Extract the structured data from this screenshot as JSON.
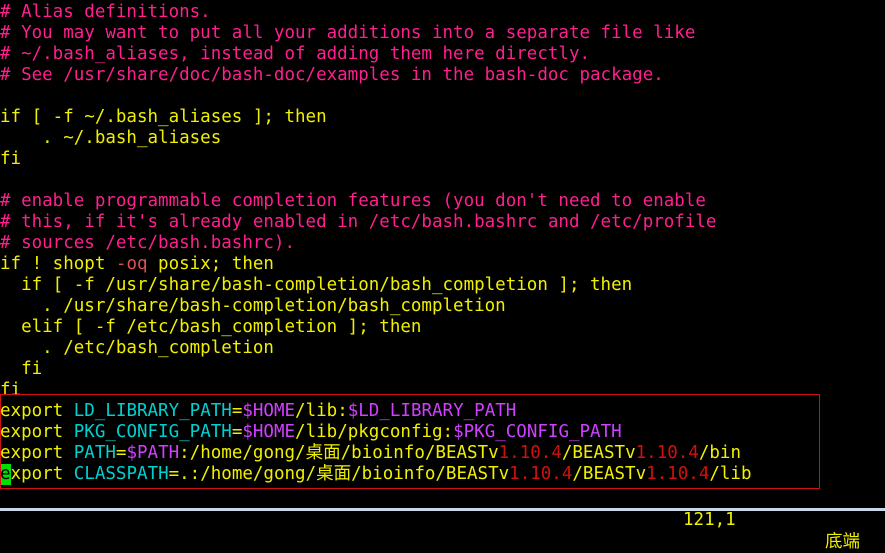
{
  "colors": {
    "background": "#000000",
    "comment": "#ff1f8f",
    "keyword": "#f0f000",
    "variable": "#d040ff",
    "name": "#00d0d0",
    "number": "#d01010",
    "cursor": "#00e000"
  },
  "lines": {
    "l1": "# Alias definitions.",
    "l2": "# You may want to put all your additions into a separate file like",
    "l3": "# ~/.bash_aliases, instead of adding them here directly.",
    "l4": "# See /usr/share/doc/bash-doc/examples in the bash-doc package.",
    "l5": "",
    "l6": "if [ -f ~/.bash_aliases ]; then",
    "l7": "    . ~/.bash_aliases",
    "l8": "fi",
    "l9": "",
    "l10": "# enable programmable completion features (you don't need to enable",
    "l11": "# this, if it's already enabled in /etc/bash.bashrc and /etc/profile",
    "l12": "# sources /etc/bash.bashrc).",
    "l13a": "if ! shopt ",
    "l13b": "-oq",
    "l13c": " posix; then",
    "l14": "  if [ -f /usr/share/bash-completion/bash_completion ]; then",
    "l15": "    . /usr/share/bash-completion/bash_completion",
    "l16": "  elif [ -f /etc/bash_completion ]; then",
    "l17": "    . /etc/bash_completion",
    "l18": "  fi",
    "l19": "fi"
  },
  "exports": {
    "e1": {
      "kw": "export",
      "name": "LD_LIBRARY_PATH",
      "eq": "=",
      "v1": "$HOME",
      "t1": "/lib:",
      "v2": "$LD_LIBRARY_PATH"
    },
    "e2": {
      "kw": "export",
      "name": "PKG_CONFIG_PATH",
      "eq": "=",
      "v1": "$HOME",
      "t1": "/lib/pkgconfig:",
      "v2": "$PKG_CONFIG_PATH"
    },
    "e3": {
      "kw": "export",
      "name": "PATH",
      "eq": "=",
      "v1": "$PATH",
      "t1": ":/home/gong/桌面/bioinfo/BEASTv",
      "n1": "1.10.4",
      "t2": "/BEASTv",
      "n2": "1.10.4",
      "t3": "/bin"
    },
    "e4": {
      "kw_cursor": "e",
      "kw_rest": "xport",
      "name": "CLASSPATH",
      "t0": "=.:/home/gong/桌面/bioinfo/BEASTv",
      "n1": "1.10.4",
      "t2": "/BEASTv",
      "n2": "1.10.4",
      "t3": "/lib"
    }
  },
  "status": {
    "position": "121,1",
    "where": "底端"
  }
}
